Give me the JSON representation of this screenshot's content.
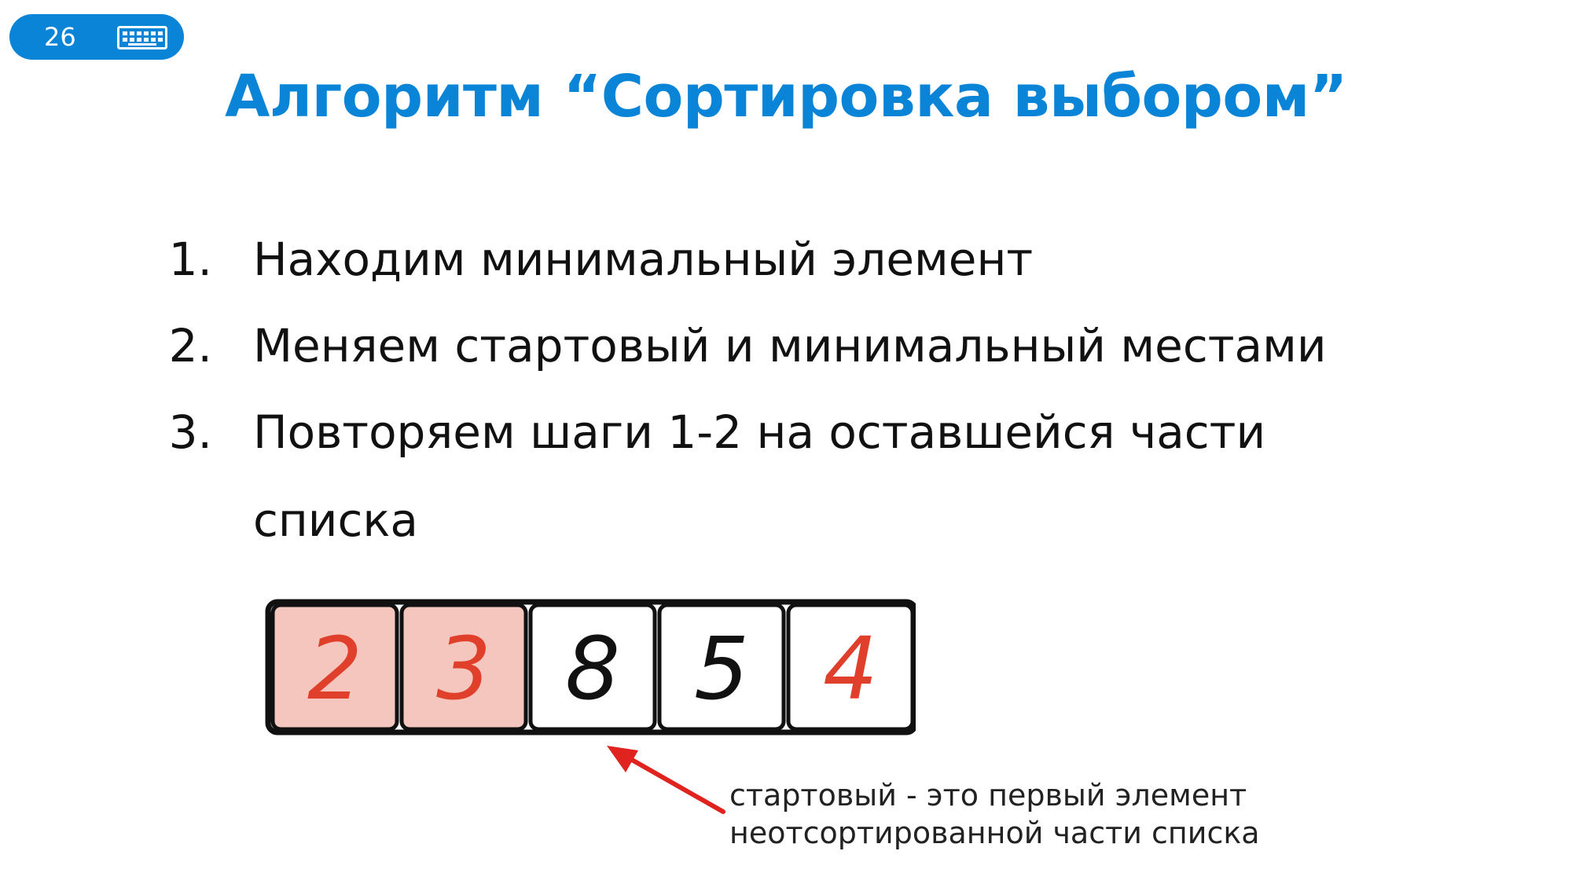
{
  "slide": {
    "number": "26",
    "title": "Алгоритм “Сортировка выбором”"
  },
  "steps": [
    {
      "num": "1.",
      "text": "Находим минимальный элемент"
    },
    {
      "num": "2.",
      "text": "Меняем стартовый и минимальный местами"
    },
    {
      "num": "3.",
      "text": "Повторяем шаги 1-2 на оставшейся части списка"
    }
  ],
  "array": {
    "cells": [
      {
        "value": "2",
        "sorted": true,
        "color": "#e0402b"
      },
      {
        "value": "3",
        "sorted": true,
        "color": "#e0402b"
      },
      {
        "value": "8",
        "sorted": false,
        "color": "#111111"
      },
      {
        "value": "5",
        "sorted": false,
        "color": "#111111"
      },
      {
        "value": "4",
        "sorted": false,
        "color": "#e0402b"
      }
    ],
    "sorted_fill": "#f4c6bd"
  },
  "caption": {
    "line1": "стартовый - это первый элемент",
    "line2": "неотсортированной части списка"
  },
  "colors": {
    "accent": "#0a84d6",
    "arrow": "#e0231f"
  },
  "icons": {
    "badge_icon": "keyboard-icon"
  }
}
